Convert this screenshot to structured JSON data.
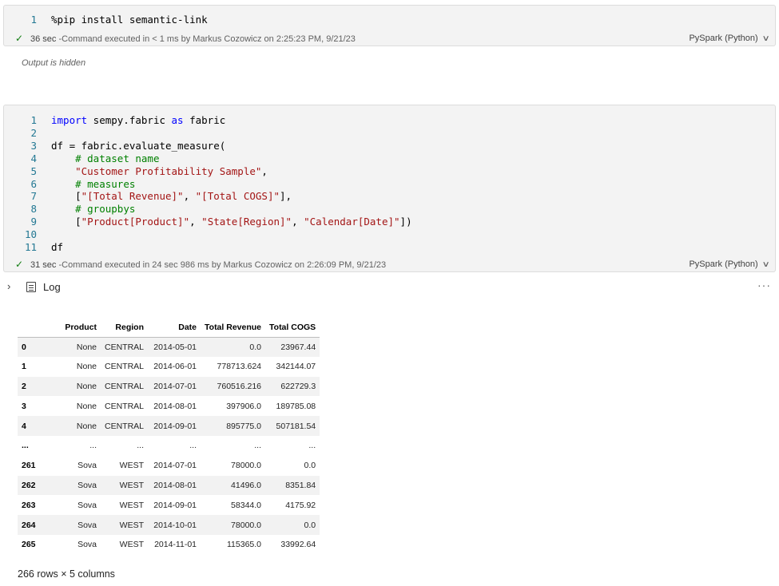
{
  "cells": [
    {
      "lines": [
        {
          "n": "1",
          "parts": [
            {
              "t": "%pip install semantic-link",
              "c": ""
            }
          ]
        }
      ],
      "status": {
        "duration": "36 sec",
        "message": "-Command executed in < 1 ms by Markus Cozowicz on 2:25:23 PM, 9/21/23",
        "language": "PySpark (Python)"
      },
      "output_note": "Output is hidden"
    },
    {
      "lines": [
        {
          "n": "1",
          "parts": [
            {
              "t": "import",
              "c": "kw"
            },
            {
              "t": " sempy.fabric ",
              "c": ""
            },
            {
              "t": "as",
              "c": "kw"
            },
            {
              "t": " fabric",
              "c": ""
            }
          ]
        },
        {
          "n": "2",
          "parts": []
        },
        {
          "n": "3",
          "parts": [
            {
              "t": "df = fabric.evaluate_measure(",
              "c": ""
            }
          ]
        },
        {
          "n": "4",
          "parts": [
            {
              "t": "    ",
              "c": ""
            },
            {
              "t": "# dataset name",
              "c": "cm"
            }
          ]
        },
        {
          "n": "5",
          "parts": [
            {
              "t": "    ",
              "c": ""
            },
            {
              "t": "\"Customer Profitability Sample\"",
              "c": "str"
            },
            {
              "t": ",",
              "c": ""
            }
          ]
        },
        {
          "n": "6",
          "parts": [
            {
              "t": "    ",
              "c": ""
            },
            {
              "t": "# measures",
              "c": "cm"
            }
          ]
        },
        {
          "n": "7",
          "parts": [
            {
              "t": "    [",
              "c": ""
            },
            {
              "t": "\"[Total Revenue]\"",
              "c": "str"
            },
            {
              "t": ", ",
              "c": ""
            },
            {
              "t": "\"[Total COGS]\"",
              "c": "str"
            },
            {
              "t": "],",
              "c": ""
            }
          ]
        },
        {
          "n": "8",
          "parts": [
            {
              "t": "    ",
              "c": ""
            },
            {
              "t": "# groupbys",
              "c": "cm"
            }
          ]
        },
        {
          "n": "9",
          "parts": [
            {
              "t": "    [",
              "c": ""
            },
            {
              "t": "\"Product[Product]\"",
              "c": "str"
            },
            {
              "t": ", ",
              "c": ""
            },
            {
              "t": "\"State[Region]\"",
              "c": "str"
            },
            {
              "t": ", ",
              "c": ""
            },
            {
              "t": "\"Calendar[Date]\"",
              "c": "str"
            },
            {
              "t": "])",
              "c": ""
            }
          ]
        },
        {
          "n": "10",
          "parts": []
        },
        {
          "n": "11",
          "parts": [
            {
              "t": "df",
              "c": ""
            }
          ]
        }
      ],
      "status": {
        "duration": "31 sec",
        "message": "-Command executed in 24 sec 986 ms by Markus Cozowicz on 2:26:09 PM, 9/21/23",
        "language": "PySpark (Python)"
      }
    }
  ],
  "log": {
    "label": "Log",
    "more": "···"
  },
  "table": {
    "columns": [
      "",
      "Product",
      "Region",
      "Date",
      "Total Revenue",
      "Total COGS"
    ],
    "rows_head": [
      [
        "0",
        "None",
        "CENTRAL",
        "2014-05-01",
        "0.0",
        "23967.44"
      ],
      [
        "1",
        "None",
        "CENTRAL",
        "2014-06-01",
        "778713.624",
        "342144.07"
      ],
      [
        "2",
        "None",
        "CENTRAL",
        "2014-07-01",
        "760516.216",
        "622729.3"
      ],
      [
        "3",
        "None",
        "CENTRAL",
        "2014-08-01",
        "397906.0",
        "189785.08"
      ],
      [
        "4",
        "None",
        "CENTRAL",
        "2014-09-01",
        "895775.0",
        "507181.54"
      ]
    ],
    "ellipsis_row": [
      "...",
      "...",
      "...",
      "...",
      "...",
      "..."
    ],
    "rows_tail": [
      [
        "261",
        "Sova",
        "WEST",
        "2014-07-01",
        "78000.0",
        "0.0"
      ],
      [
        "262",
        "Sova",
        "WEST",
        "2014-08-01",
        "41496.0",
        "8351.84"
      ],
      [
        "263",
        "Sova",
        "WEST",
        "2014-09-01",
        "58344.0",
        "4175.92"
      ],
      [
        "264",
        "Sova",
        "WEST",
        "2014-10-01",
        "78000.0",
        "0.0"
      ],
      [
        "265",
        "Sova",
        "WEST",
        "2014-11-01",
        "115365.0",
        "33992.64"
      ]
    ],
    "summary": "266 rows × 5 columns"
  },
  "icons": {
    "check": "✓",
    "chevron": "∨",
    "expand": "›"
  }
}
